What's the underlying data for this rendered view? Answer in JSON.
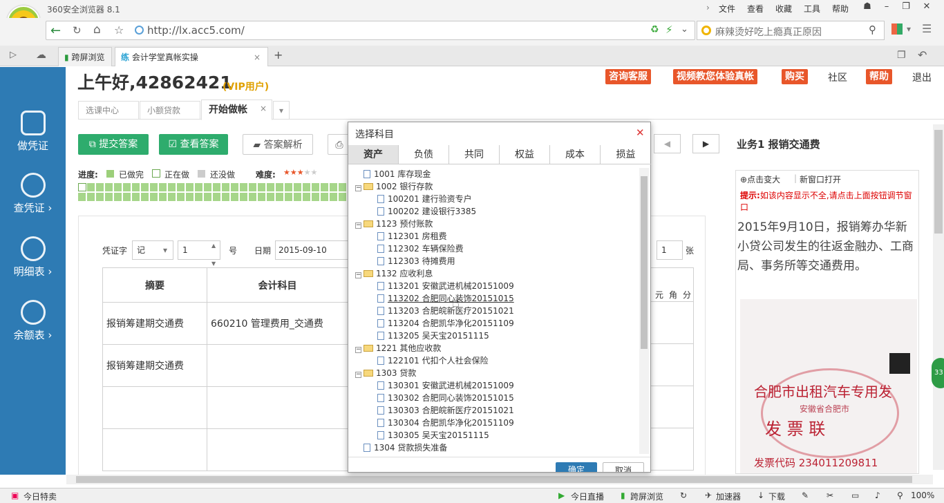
{
  "browser": {
    "title": "360安全浏览器 8.1",
    "url": "http://lx.acc5.com/",
    "search": "麻辣烫好吃上瘾真正原因",
    "menus": [
      "文件",
      "查看",
      "收藏",
      "工具",
      "帮助"
    ]
  },
  "tabs": {
    "split": "跨屏浏览",
    "active": "会计学堂真帐实操",
    "add": "+"
  },
  "header": {
    "greeting": "上午好,42862421",
    "vip": "(VIP用户)",
    "links": [
      "咨询客服",
      "视频教您体验真帐",
      "购买"
    ],
    "community": "社区",
    "help": "帮助",
    "logout": "退出"
  },
  "subtabs": [
    "选课中心",
    "小额贷款",
    "开始做帐"
  ],
  "sidebar": [
    {
      "label": "做凭证",
      "icon": "form-icon"
    },
    {
      "label": "查凭证 ›",
      "icon": "search-icon"
    },
    {
      "label": "明细表 ›",
      "icon": "list-icon"
    },
    {
      "label": "余额表 ›",
      "icon": "list-icon"
    }
  ],
  "toolbar": {
    "submit": "提交答案",
    "view": "查看答案",
    "analysis": "答案解析"
  },
  "progress": {
    "label": "进度:",
    "done": "已做完",
    "doing": "正在做",
    "todo": "还没做",
    "difficulty": "难度:"
  },
  "voucher": {
    "word_label": "凭证字",
    "word": "记",
    "num": "1",
    "num_suffix": "号",
    "date_label": "日期",
    "date": "2015-09-10",
    "attach": "1",
    "attach_suffix": "张",
    "col_summary": "摘要",
    "col_account": "会计科目",
    "units": [
      "元",
      "角",
      "分"
    ]
  },
  "rows": [
    {
      "summary": "报销筹建期交通费",
      "account": "660210 管理费用_交通费"
    },
    {
      "summary": "报销筹建期交通费",
      "account": ""
    },
    {
      "summary": "",
      "account": ""
    },
    {
      "summary": "",
      "account": ""
    }
  ],
  "dialog": {
    "title": "选择科目",
    "tabs": [
      "资产",
      "负债",
      "共同",
      "权益",
      "成本",
      "损益"
    ],
    "ok": "确定",
    "cancel": "取消",
    "tree": [
      {
        "t": "1001 库存现金",
        "l": 0,
        "f": false
      },
      {
        "t": "1002 银行存款",
        "l": 0,
        "f": true
      },
      {
        "t": "100201 建行验资专户",
        "l": 1,
        "f": false
      },
      {
        "t": "100202 建设银行3385",
        "l": 1,
        "f": false
      },
      {
        "t": "1123 预付账款",
        "l": 0,
        "f": true
      },
      {
        "t": "112301 房租费",
        "l": 1,
        "f": false
      },
      {
        "t": "112302 车辆保险费",
        "l": 1,
        "f": false
      },
      {
        "t": "112303 待摊费用",
        "l": 1,
        "f": false
      },
      {
        "t": "1132 应收利息",
        "l": 0,
        "f": true
      },
      {
        "t": "113201 安徽武进机械20151009",
        "l": 1,
        "f": false
      },
      {
        "t": "113202 合肥同心装饰20151015",
        "l": 1,
        "f": false
      },
      {
        "t": "113203 合肥皖新医疗20151021",
        "l": 1,
        "f": false
      },
      {
        "t": "113204 合肥凯华净化20151109",
        "l": 1,
        "f": false
      },
      {
        "t": "113205 吴天宝20151115",
        "l": 1,
        "f": false
      },
      {
        "t": "1221 其他应收款",
        "l": 0,
        "f": true
      },
      {
        "t": "122101 代扣个人社会保险",
        "l": 1,
        "f": false
      },
      {
        "t": "1303 贷款",
        "l": 0,
        "f": true
      },
      {
        "t": "130301 安徽武进机械20151009",
        "l": 1,
        "f": false
      },
      {
        "t": "130302 合肥同心装饰20151015",
        "l": 1,
        "f": false
      },
      {
        "t": "130303 合肥皖新医疗20151021",
        "l": 1,
        "f": false
      },
      {
        "t": "130304 合肥凯华净化20151109",
        "l": 1,
        "f": false
      },
      {
        "t": "130305 吴天宝20151115",
        "l": 1,
        "f": false
      },
      {
        "t": "1304 贷款损失准备",
        "l": 0,
        "f": false
      }
    ]
  },
  "right": {
    "title": "业务1 报销交通费",
    "zoom": "点击变大",
    "newwin": "新窗口打开",
    "tip_label": "提示:",
    "tip": "如该内容显示不全,请点击上面按钮调节窗口",
    "desc": "2015年9月10日，报销筹办华新小贷公司发生的往返金融办、工商局、事务所等交通费用。",
    "invoice_title": "合肥市出租汽车专用发",
    "invoice_sub": "安徽省合肥市",
    "invoice_big": "发 票 联",
    "invoice_code": "发票代码 234011209811"
  },
  "status": {
    "left": "今日特卖",
    "items": [
      "今日直播",
      "跨屏浏览",
      "加速器",
      "下载"
    ],
    "zoom": "100%"
  }
}
